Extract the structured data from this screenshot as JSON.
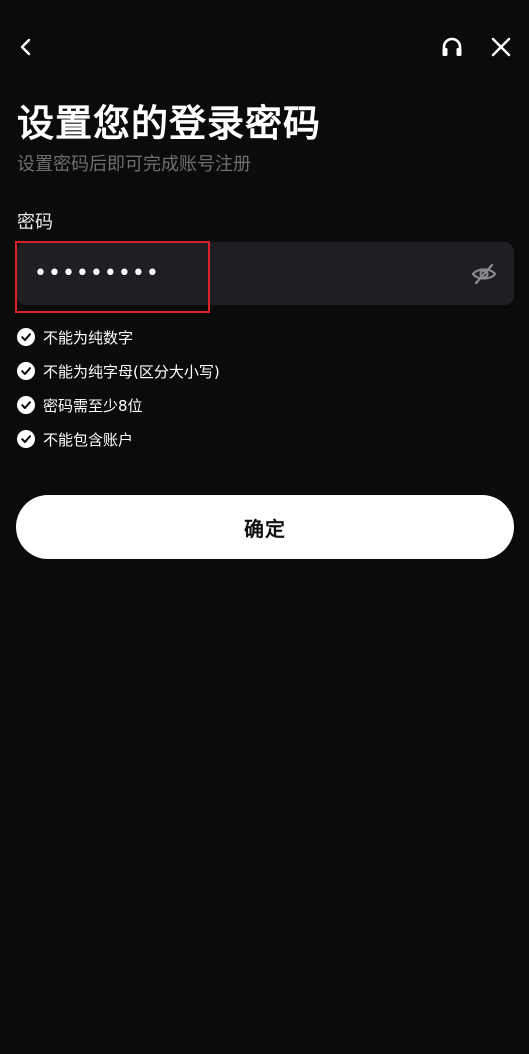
{
  "header": {
    "back_icon": "chevron-left-icon",
    "support_icon": "headset-icon",
    "close_icon": "close-icon"
  },
  "title": "设置您的登录密码",
  "subtitle": "设置密码后即可完成账号注册",
  "password_field": {
    "label": "密码",
    "value": "•••••••••",
    "visibility_icon": "eye-off-icon"
  },
  "rules": [
    {
      "text": "不能为纯数字",
      "icon": "check-circle-icon"
    },
    {
      "text": "不能为纯字母(区分大小写)",
      "icon": "check-circle-icon"
    },
    {
      "text": "密码需至少8位",
      "icon": "check-circle-icon"
    },
    {
      "text": "不能包含账户",
      "icon": "check-circle-icon"
    }
  ],
  "confirm_button": {
    "label": "确定"
  },
  "colors": {
    "background": "#0b0b0b",
    "input_background": "#1f1f23",
    "subtitle": "#6e6e73",
    "highlight": "#d8232a",
    "button_background": "#ffffff"
  }
}
